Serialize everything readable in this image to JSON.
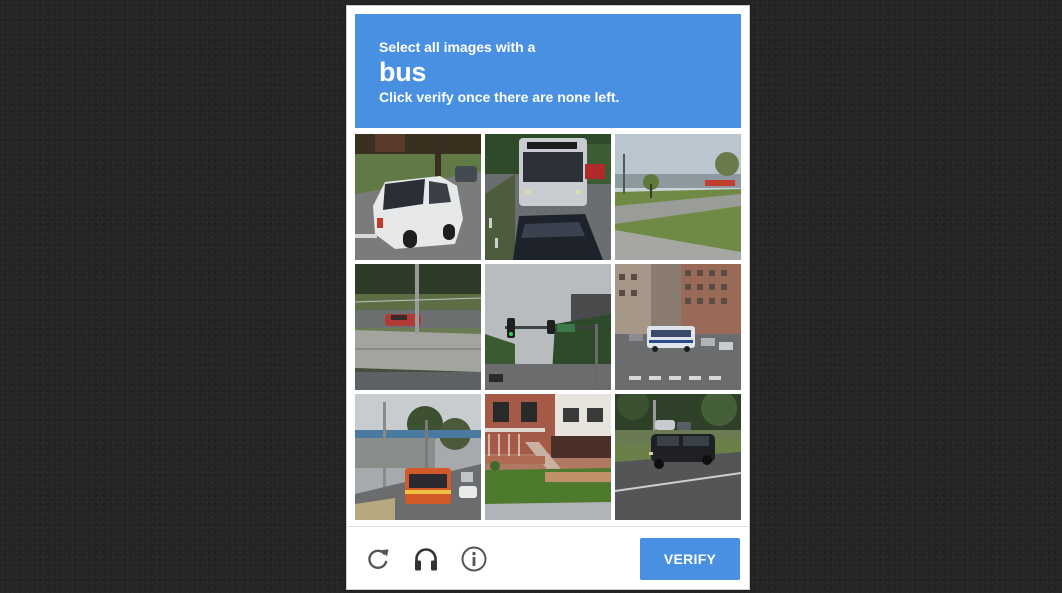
{
  "header": {
    "instruction": "Select all images with a",
    "keyword": "bus",
    "subtext": "Click verify once there are none left."
  },
  "tiles": [
    {
      "scene": "white minivan parked on street"
    },
    {
      "scene": "city bus approaching behind car"
    },
    {
      "scene": "empty road with grass and sidewalk"
    },
    {
      "scene": "highway barrier with red car"
    },
    {
      "scene": "traffic light over road"
    },
    {
      "scene": "bus on avenue with tall buildings"
    },
    {
      "scene": "orange bus at transit station"
    },
    {
      "scene": "brick house with steps"
    },
    {
      "scene": "dark suv on road"
    }
  ],
  "footer": {
    "reload_icon": "reload-icon",
    "audio_icon": "headphones-icon",
    "info_icon": "info-icon",
    "verify_label": "VERIFY"
  },
  "colors": {
    "accent": "#4a90e2",
    "background": "#252525",
    "icon": "#555555"
  }
}
